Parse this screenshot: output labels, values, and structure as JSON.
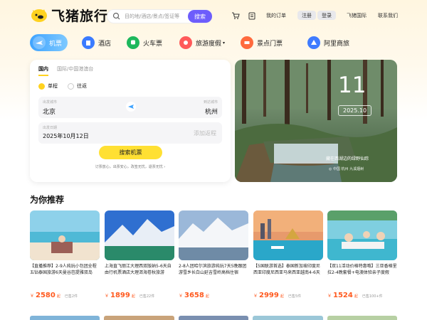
{
  "header": {
    "logo_text": "飞猪旅行",
    "search_placeholder": "目的地/酒店/景点/签证等",
    "search_button": "搜索",
    "my_orders": "我的订单",
    "register": "注册",
    "login": "登录",
    "intl": "飞猪国际",
    "contact": "联系我们"
  },
  "nav": [
    {
      "label": "机票",
      "icon": "plane-icon",
      "color": "#3ea3ff"
    },
    {
      "label": "酒店",
      "icon": "hotel-icon",
      "color": "#3a7bff"
    },
    {
      "label": "火车票",
      "icon": "train-icon",
      "color": "#1db85c"
    },
    {
      "label": "旅游度假",
      "icon": "vacation-icon",
      "color": "#ff5a5a"
    },
    {
      "label": "景点门票",
      "icon": "ticket-icon",
      "color": "#ff6a3d"
    },
    {
      "label": "阿里商旅",
      "icon": "business-icon",
      "color": "#3f7bff"
    }
  ],
  "booking": {
    "tab_domestic": "国内",
    "tab_intl": "国际/中国港澳台",
    "one_way": "单程",
    "round_trip": "往返",
    "from_label": "出发城市",
    "from_city": "北京",
    "to_label": "到达城市",
    "to_city": "杭州",
    "date_label": "出发日期",
    "date": "2025年10月12日",
    "return_placeholder": "添加返程",
    "search_button": "搜索机票",
    "guarantee": "订票放心，出票安心，改签无忧，退票无忧 ›"
  },
  "banner": {
    "day": "11",
    "date": "2025.10",
    "quote": "藏在西湖边的绿野仙踪",
    "location": "◎ 中国 杭州 九溪烟树"
  },
  "recommend": {
    "title": "为你推荐",
    "items": [
      {
        "desc": "【直播推荐】2-9人纯玩小包团全程五钻泰国旅游6天曼谷芭提雅双岛",
        "price": "2580",
        "sold": "已售2件"
      },
      {
        "desc": "上海直飞丽江大理西双版纳5-6天自由行机票酒店大理洱海卷秋旅游",
        "price": "1899",
        "sold": "已售22件"
      },
      {
        "desc": "2-8人团哈尔滨旅游纯玩7天5晚跟团游雪乡长白山延吉雪岭高档住宿",
        "price": "3658",
        "sold": ""
      },
      {
        "desc": "【5国联游首选】泰国新加坡印度尼西亚印度尼西亚马来西亚越南4-6天",
        "price": "2999",
        "sold": "已售5件"
      },
      {
        "desc": "【双11活动价格特惠哦】三亚香格里拉2-4晚套餐+电澳体验亲子度假",
        "price": "1524",
        "sold": "已售100+件"
      }
    ],
    "currency": "￥",
    "qi": "起"
  }
}
